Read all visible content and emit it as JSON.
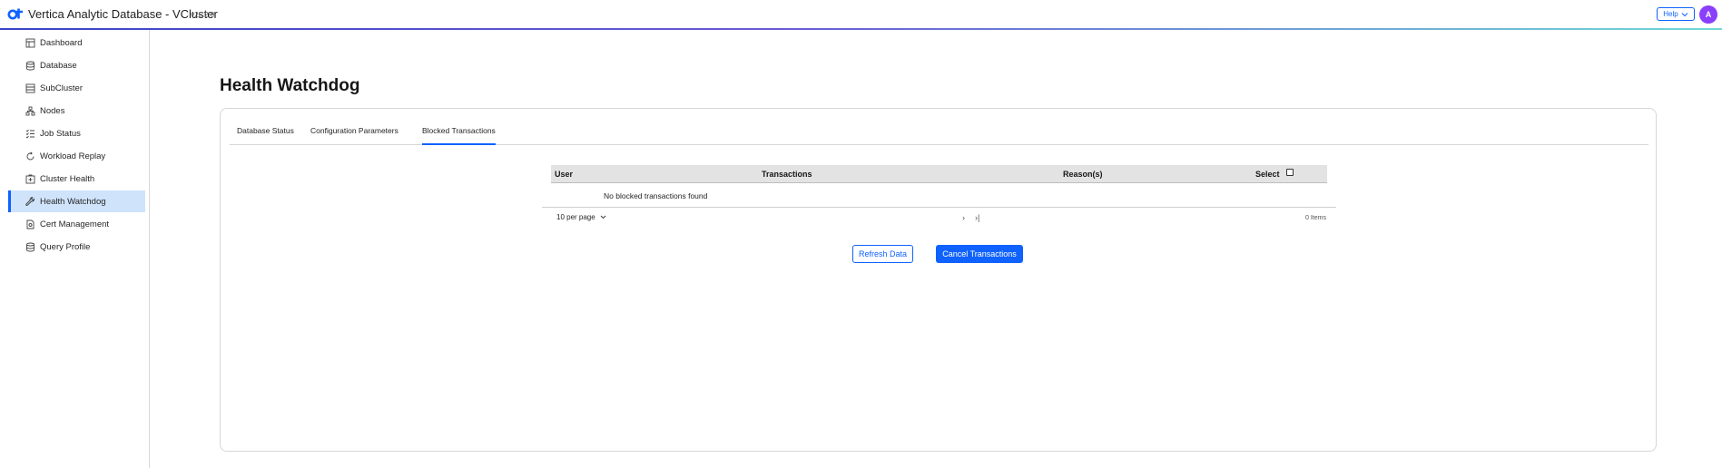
{
  "header": {
    "logo_text": "ot",
    "title": "Vertica Analytic Database - VCluster",
    "version": "v26.2.0",
    "help_label": "Help",
    "avatar_initial": "A"
  },
  "colors": {
    "accent": "#0f62fe",
    "active_nav_bg": "#cfe3fb",
    "avatar_bg": "#8a3ffc"
  },
  "sidebar": {
    "items": [
      {
        "label": "Dashboard",
        "icon": "dashboard-icon"
      },
      {
        "label": "Database",
        "icon": "database-icon"
      },
      {
        "label": "SubCluster",
        "icon": "subcluster-icon"
      },
      {
        "label": "Nodes",
        "icon": "nodes-icon"
      },
      {
        "label": "Job Status",
        "icon": "job-status-icon"
      },
      {
        "label": "Workload Replay",
        "icon": "replay-icon"
      },
      {
        "label": "Cluster Health",
        "icon": "cluster-health-icon"
      },
      {
        "label": "Health Watchdog",
        "icon": "wrench-icon",
        "active": true
      },
      {
        "label": "Cert Management",
        "icon": "certificate-icon"
      },
      {
        "label": "Query Profile",
        "icon": "query-profile-icon"
      }
    ]
  },
  "main": {
    "title": "Health Watchdog",
    "tabs": [
      {
        "label": "Database Status"
      },
      {
        "label": "Configuration Parameters"
      },
      {
        "label": "Blocked Transactions",
        "active": true
      }
    ],
    "table": {
      "columns": [
        "User",
        "Transactions",
        "Reason(s)",
        "Select"
      ],
      "empty_message": "No blocked transactions found"
    },
    "pagination": {
      "per_page": "10 per page",
      "items_count": "0 Items"
    },
    "buttons": {
      "refresh": "Refresh Data",
      "cancel": "Cancel Transactions"
    }
  }
}
